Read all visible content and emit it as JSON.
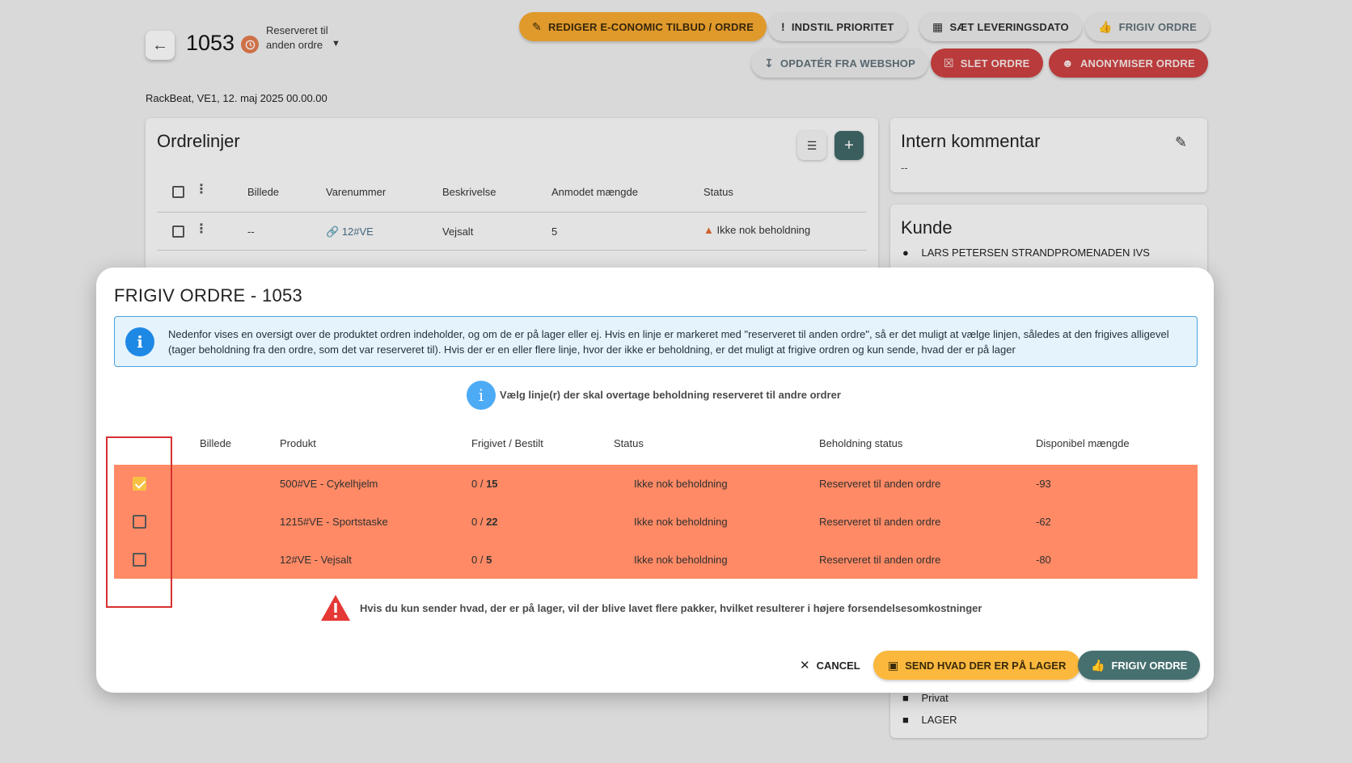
{
  "page": {
    "order_number": "1053",
    "status_label": "Reserveret til anden ordre",
    "meta_line": "RackBeat, VE1, 12. maj 2025 00.00.00"
  },
  "toolbar": {
    "edit_label": "REDIGER E-CONOMIC TILBUD / ORDRE",
    "priority_label": "INDSTIL PRIORITET",
    "delivery_label": "SÆT LEVERINGSDATO",
    "release_label": "FRIGIV ORDRE",
    "update_label": "OPDATÉR FRA WEBSHOP",
    "delete_label": "SLET ORDRE",
    "anonymize_label": "ANONYMISER ORDRE"
  },
  "orderlines": {
    "title": "Ordrelinjer",
    "headers": [
      "Billede",
      "Varenummer",
      "Beskrivelse",
      "Anmodet mængde",
      "Status"
    ],
    "row": {
      "image": "--",
      "sku": "12#VE",
      "description": "Vejsalt",
      "qty": "5",
      "status": "Ikke nok beholdning"
    }
  },
  "comment": {
    "title": "Intern kommentar",
    "value": "--"
  },
  "customer": {
    "title": "Kunde",
    "name": "LARS PETERSEN STRANDPROMENADEN IVS",
    "type": "Privat",
    "warehouse": "LAGER"
  },
  "modal": {
    "title": "FRIGIV ORDRE - 1053",
    "info_text": "Nedenfor vises en oversigt over de produktet ordren indeholder, og om de er på lager eller ej. Hvis en linje er markeret med \"reserveret til anden ordre\", så er det muligt at vælge linjen, således at den frigives alligevel (tager beholdning fra den ordre, som det var reserveret til). Hvis der er en eller flere linje, hvor der ikke er beholdning, er det muligt at frigive ordren og kun sende, hvad der er på lager",
    "hint": "Vælg linje(r) der skal overtage beholdning reserveret til andre ordrer",
    "headers": {
      "image": "Billede",
      "product": "Produkt",
      "released": "Frigivet / Bestilt",
      "status": "Status",
      "stock_status": "Beholdning status",
      "available": "Disponibel mængde"
    },
    "rows": [
      {
        "checked": true,
        "product": "500#VE - Cykelhjelm",
        "released": "0",
        "ordered": "15",
        "status": "Ikke nok beholdning",
        "stock_status": "Reserveret til anden ordre",
        "available": "-93"
      },
      {
        "checked": false,
        "product": "1215#VE - Sportstaske",
        "released": "0",
        "ordered": "22",
        "status": "Ikke nok beholdning",
        "stock_status": "Reserveret til anden ordre",
        "available": "-62"
      },
      {
        "checked": false,
        "product": "12#VE - Vejsalt",
        "released": "0",
        "ordered": "5",
        "status": "Ikke nok beholdning",
        "stock_status": "Reserveret til anden ordre",
        "available": "-80"
      }
    ],
    "warning": "Hvis du kun sender hvad, der er på lager, vil der blive lavet flere pakker, hvilket resulterer i højere forsendelsesomkostninger",
    "cancel_label": "CANCEL",
    "send_label": "SEND HVAD DER ER PÅ LAGER",
    "release_label": "FRIGIV ORDRE"
  },
  "colors": {
    "row_background": "#ff8a65",
    "primary_button": "#46706f",
    "send_button": "#fbb83d",
    "info_blue": "#1e88e5",
    "danger_red": "#c94040"
  }
}
